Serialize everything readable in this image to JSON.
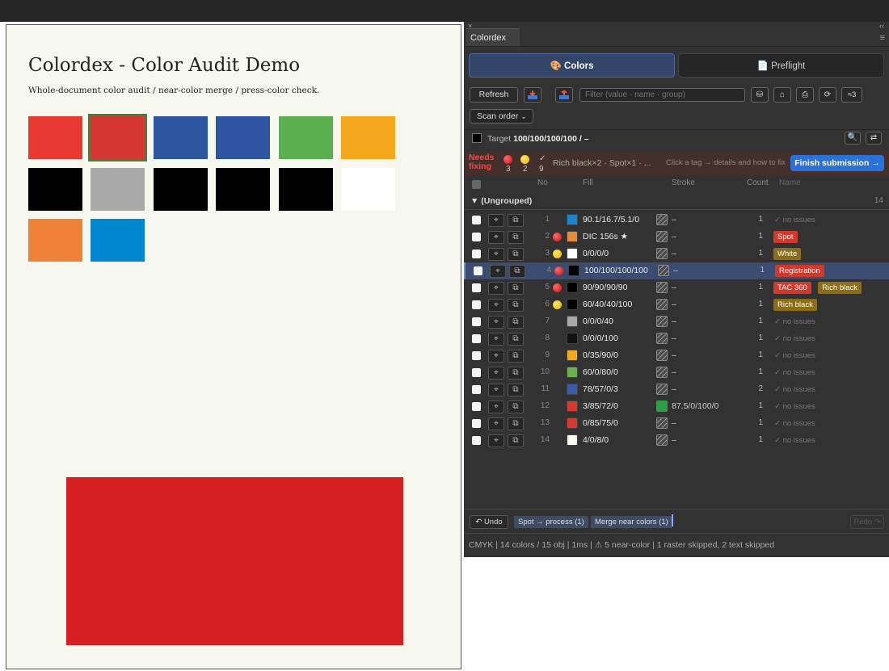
{
  "document": {
    "title": "Colordex - Color Audit Demo",
    "subtitle": "Whole-document color audit / near-color merge / press-color check.",
    "swatch_colors": [
      "#e83a32",
      "#d63632",
      "#2d55a0",
      "#2f55a2",
      "#5ab04e",
      "#f5a71c",
      "#000000",
      "#a9a9a9",
      "#000000",
      "#000000",
      "#000000",
      "#ffffff",
      "#ee8337",
      "#0186d0"
    ],
    "selected_swatch_border": "#2f8c3a",
    "big_rect_color": "#d51f20"
  },
  "panel": {
    "close_glyph": "×",
    "collapse_glyph": "‹‹",
    "tab_title": "Colordex",
    "menu_glyph": "≡",
    "tabs": {
      "colors": "🎨 Colors",
      "preflight": "📄 Preflight"
    },
    "toolbar": {
      "refresh": "Refresh",
      "filter_placeholder": "Filter (value · name · group)",
      "near_count": "≈3",
      "scan_order": "Scan order",
      "icon_glyphs": {
        "stack": "⛁",
        "tag": "⌂",
        "print": "⎙",
        "sync": "⟳",
        "search": "🔍",
        "swap": "⇄"
      }
    },
    "target": {
      "label": "Target",
      "value": "100/100/100/100 / –"
    },
    "needs": {
      "label_line1": "Needs",
      "label_line2": "fixing",
      "red_count": "3",
      "yellow_count": "2",
      "ok_glyph": "✓",
      "ok_count": "9",
      "tags_summary": "Rich black×2 · Spot×1 · ...",
      "hint": "Click a tag → details and how to fix",
      "finish": "Finish submission →"
    },
    "columns": {
      "no": "No",
      "fill": "Fill",
      "stroke": "Stroke",
      "count": "Count",
      "name": "Name"
    },
    "group": {
      "label": "▼ (Ungrouped)",
      "count": "14"
    },
    "row_icon_glyphs": {
      "locate": "⌖",
      "copy": "⧉"
    },
    "rows": [
      {
        "no": "1",
        "status": "none",
        "fill_color": "#1a86d0",
        "fill": "90.1/16.7/5.1/0",
        "stroke_color": "none",
        "stroke": "–",
        "count": "1",
        "ok": "✓ no issues",
        "tags": []
      },
      {
        "no": "2",
        "status": "red",
        "fill_color": "#e08a3c",
        "fill": "DIC 156s ★",
        "stroke_color": "none",
        "stroke": "–",
        "count": "1",
        "ok": "",
        "tags": [
          {
            "label": "Spot",
            "color": "#d03a2c"
          }
        ]
      },
      {
        "no": "3",
        "status": "yellow",
        "fill_color": "#ffffff",
        "fill": "0/0/0/0",
        "stroke_color": "none",
        "stroke": "–",
        "count": "1",
        "ok": "",
        "tags": [
          {
            "label": "White",
            "color": "#8a6d14"
          }
        ]
      },
      {
        "no": "4",
        "status": "red",
        "fill_color": "#000000",
        "fill": "100/100/100/100",
        "stroke_color": "none",
        "stroke": "–",
        "count": "1",
        "ok": "",
        "tags": [
          {
            "label": "Registration",
            "color": "#d03a2c"
          }
        ],
        "selected": true
      },
      {
        "no": "5",
        "status": "red",
        "fill_color": "#000000",
        "fill": "90/90/90/90",
        "stroke_color": "none",
        "stroke": "–",
        "count": "1",
        "ok": "",
        "tags": [
          {
            "label": "TAC 360",
            "color": "#d03a2c"
          },
          {
            "label": "Rich black",
            "color": "#8a6d14"
          }
        ]
      },
      {
        "no": "6",
        "status": "yellow",
        "fill_color": "#000000",
        "fill": "60/40/40/100",
        "stroke_color": "none",
        "stroke": "–",
        "count": "1",
        "ok": "",
        "tags": [
          {
            "label": "Rich black",
            "color": "#8a6d14"
          }
        ]
      },
      {
        "no": "7",
        "status": "none",
        "fill_color": "#a9a9a9",
        "fill": "0/0/0/40",
        "stroke_color": "none",
        "stroke": "–",
        "count": "1",
        "ok": "✓ no issues",
        "tags": []
      },
      {
        "no": "8",
        "status": "none",
        "fill_color": "#111111",
        "fill": "0/0/0/100",
        "stroke_color": "none",
        "stroke": "–",
        "count": "1",
        "ok": "✓ no issues",
        "tags": []
      },
      {
        "no": "9",
        "status": "none",
        "fill_color": "#f2a722",
        "fill": "0/35/90/0",
        "stroke_color": "none",
        "stroke": "–",
        "count": "1",
        "ok": "✓ no issues",
        "tags": []
      },
      {
        "no": "10",
        "status": "none",
        "fill_color": "#6bb04e",
        "fill": "60/0/80/0",
        "stroke_color": "none",
        "stroke": "–",
        "count": "1",
        "ok": "✓ no issues",
        "tags": []
      },
      {
        "no": "11",
        "status": "none",
        "fill_color": "#3a5ba8",
        "fill": "78/57/0/3",
        "stroke_color": "none",
        "stroke": "–",
        "count": "2",
        "ok": "✓ no issues",
        "tags": []
      },
      {
        "no": "12",
        "status": "none",
        "fill_color": "#d63830",
        "fill": "3/85/72/0",
        "stroke_color": "#2f9c48",
        "stroke": "87.5/0/100/0",
        "count": "1",
        "ok": "✓ no issues",
        "tags": []
      },
      {
        "no": "13",
        "status": "none",
        "fill_color": "#d63a30",
        "fill": "0/85/75/0",
        "stroke_color": "none",
        "stroke": "–",
        "count": "1",
        "ok": "✓ no issues",
        "tags": []
      },
      {
        "no": "14",
        "status": "none",
        "fill_color": "#fbf8ef",
        "fill": "4/0/8/0",
        "stroke_color": "none",
        "stroke": "–",
        "count": "1",
        "ok": "✓ no issues",
        "tags": []
      }
    ],
    "history": {
      "undo": "↶ Undo",
      "items": [
        "Spot → process (1)",
        "Merge near colors (1)"
      ],
      "redo": "Redo ↷"
    },
    "status": "CMYK | 14 colors / 15 obj | 1ms | ⚠ 5 near-color | 1 raster skipped, 2 text skipped"
  }
}
